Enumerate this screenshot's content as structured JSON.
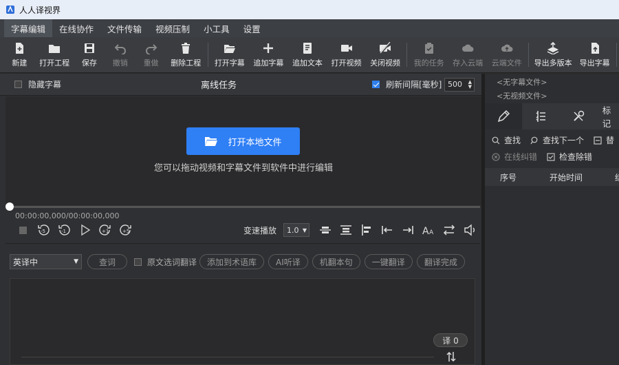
{
  "window": {
    "title": "人人译视界"
  },
  "menu": [
    "字幕编辑",
    "在线协作",
    "文件传输",
    "视频压制",
    "小工具",
    "设置"
  ],
  "toolbar": {
    "new": "新建",
    "open_project": "打开工程",
    "save": "保存",
    "undo": "撤销",
    "redo": "重做",
    "delete_project": "删除工程",
    "open_subtitle": "打开字幕",
    "add_subtitle": "追加字幕",
    "add_text": "追加文本",
    "open_video": "打开视频",
    "close_video": "关闭视频",
    "my_tasks": "我的任务",
    "save_cloud": "存入云端",
    "cloud_files": "云端文件",
    "export_multi": "导出多版本",
    "export_subtitle": "导出字幕"
  },
  "subbar": {
    "hide_subtitle": "隐藏字幕",
    "center_title": "离线任务",
    "refresh_label": "刷新间隔[毫秒]",
    "refresh_value": "500"
  },
  "video": {
    "open_button": "打开本地文件",
    "drop_hint": "您可以拖动视频和字幕文件到软件中进行编辑",
    "timecode": "00:00:00,000/00:00:00,000"
  },
  "playback": {
    "speed_label": "变速播放",
    "speed_value": "1.0",
    "progress": 0
  },
  "translate": {
    "language": "英译中",
    "lookup": "查词",
    "select_translate": "原文选词翻译",
    "add_term": "添加到术语库",
    "ai_listen": "AI听译",
    "machine_translate": "机翻本句",
    "one_click": "一键翻译",
    "done": "翻译完成",
    "badge": "译 0"
  },
  "right": {
    "no_subtitle": "<无字幕文件>",
    "no_video": "<无视频文件>",
    "tab_text": "标记",
    "find": "查找",
    "find_next": "查找下一个",
    "replace": "替",
    "online_correct": "在线纠错",
    "check_errors": "检查除错",
    "col_index": "序号",
    "col_start": "开始时间",
    "col_end": "结"
  }
}
